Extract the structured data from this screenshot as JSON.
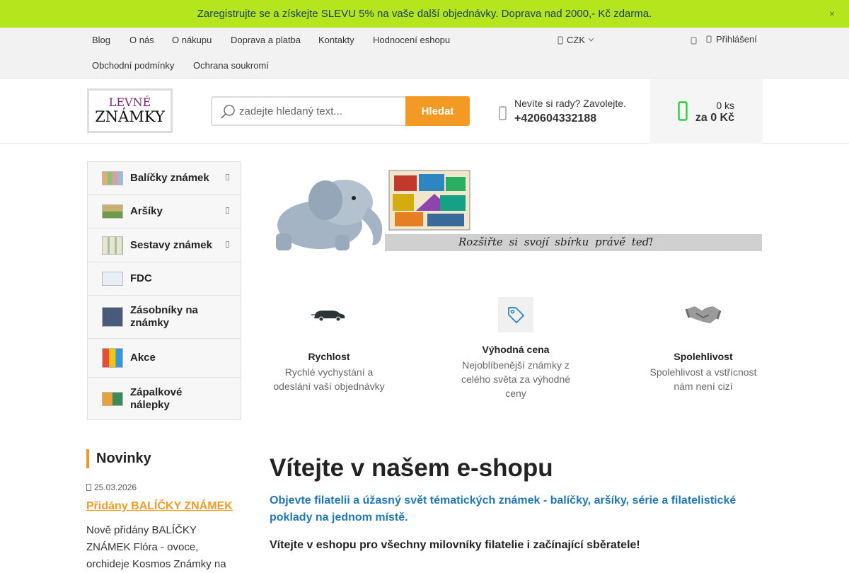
{
  "promo": {
    "text": "Zaregistrujte se a získejte SLEVU 5% na vaše další objednávky. Doprava nad 2000,- Kč zdarma.",
    "close": "×"
  },
  "topnav": {
    "links": [
      "Blog",
      "O nás",
      "O nákupu",
      "Doprava a platba",
      "Kontakty",
      "Hodnocení eshopu",
      "Obchodní podmínky",
      "Ochrana soukromí"
    ],
    "currency": "CZK",
    "login": "Přihlášení"
  },
  "logo": {
    "line1": "LEVNÉ",
    "line2": "ZNÁMKY"
  },
  "search": {
    "placeholder": "zadejte hledaný text...",
    "button": "Hledat"
  },
  "contact": {
    "text": "Nevíte si rady? Zavolejte.",
    "phone": "+420604332188"
  },
  "cart": {
    "quantity": "0 ks",
    "price": "za 0 Kč"
  },
  "categories": [
    {
      "label": "Balíčky známek",
      "has_sub": true
    },
    {
      "label": "Aršíky",
      "has_sub": true
    },
    {
      "label": "Sestavy známek",
      "has_sub": true
    },
    {
      "label": "FDC",
      "has_sub": false
    },
    {
      "label": "Zásobníky na známky",
      "has_sub": false
    },
    {
      "label": "Akce",
      "has_sub": false
    },
    {
      "label": "Zápalkové nálepky",
      "has_sub": false
    }
  ],
  "banner": {
    "caption": "Rozšiřte si svojí sbírku právě teď!"
  },
  "features": [
    {
      "title": "Rychlost",
      "desc": "Rychlé vychystání a odeslání vaší objednávky",
      "icon": "car-icon"
    },
    {
      "title": "Výhodná cena",
      "desc": "Nejoblíbenější známky z celého světa za výhodné ceny",
      "icon": "price-tag-icon"
    },
    {
      "title": "Spolehlivost",
      "desc": "Spolehlivost a vstřícnost nám není cizí",
      "icon": "handshake-icon"
    }
  ],
  "news": {
    "heading": "Novinky",
    "date": "25.03.2026",
    "title": "Přidány BALÍČKY ZNÁMEK",
    "text": "Nově přidány BALÍČKY ZNÁMEK Flóra - ovoce, orchideje Kosmos Známky na"
  },
  "welcome": {
    "title": "Vítejte v našem e-shopu",
    "subtitle": "Objevte filatelii a úžasný svět tématických známek - balíčky, aršíky, série a filatelistické poklady na jednom místě.",
    "intro": "Vítejte v eshopu pro všechny milovníky filatelie i začínající sběratele!"
  },
  "colors": {
    "accent": "#f39a24",
    "promo_bg": "#b5e61d",
    "link_blue": "#1f78b4",
    "phone_green": "#2ecc40"
  }
}
